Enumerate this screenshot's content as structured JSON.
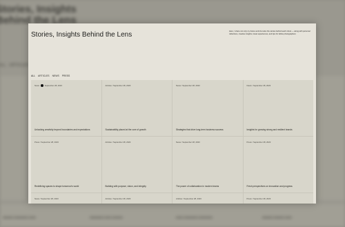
{
  "page": {
    "headline": "Stories, Insights Behind the Lens",
    "intro_text": "Here, I share not only my future work but also the stories behind each shoot — along with personal reflections, creative insights, travel experiences, and tips for fellow photographers",
    "intro_bold": "for fellow photographers"
  },
  "tabs": [
    {
      "label": "ALL",
      "active": true
    },
    {
      "label": "ARTICLES",
      "active": false
    },
    {
      "label": "NEWS",
      "active": false
    },
    {
      "label": "PRESS",
      "active": false
    }
  ],
  "cards": [
    {
      "category": "News",
      "date": "September 28, 2023",
      "title": "Unlocking creativity beyond boundaries and expectations",
      "cursor": true
    },
    {
      "category": "Articles",
      "date": "September 28, 2023",
      "title": "Sustainability placed at the core of growth"
    },
    {
      "category": "News",
      "date": "September 28, 2023",
      "title": "Strategies that drive long-term business success"
    },
    {
      "category": "News",
      "date": "September 28, 2023",
      "title": "Insights for growing strong and resilient brands"
    },
    {
      "category": "Press",
      "date": "September 28, 2023",
      "title": "Redefining spaces to shape tomorrow's world"
    },
    {
      "category": "Articles",
      "date": "September 28, 2023",
      "title": "Building with purpose, vision, and integrity"
    },
    {
      "category": "News",
      "date": "September 28, 2023",
      "title": "The power of collaboration in modern teams"
    },
    {
      "category": "Press",
      "date": "September 28, 2023",
      "title": "Fresh perspectives on innovation and progress"
    },
    {
      "category": "News",
      "date": "September 28, 2023",
      "title": ""
    },
    {
      "category": "Articles",
      "date": "September 28, 2023",
      "title": ""
    },
    {
      "category": "Articles",
      "date": "September 28, 2023",
      "title": ""
    },
    {
      "category": "Press",
      "date": "September 28, 2023",
      "title": ""
    }
  ],
  "colors": {
    "panel_bg": "#e6e3da",
    "card_bg": "#d8d6cb",
    "backdrop": "#9a988f",
    "text": "#1e1e1c"
  }
}
